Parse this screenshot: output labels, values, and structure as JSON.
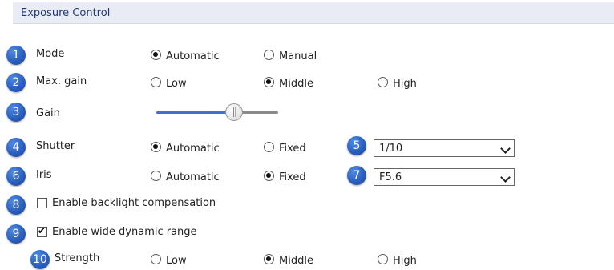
{
  "section_title": "Exposure Control",
  "rows": {
    "mode": {
      "num": "1",
      "label": "Mode",
      "options": [
        "Automatic",
        "Manual"
      ],
      "selected": "Automatic"
    },
    "max_gain": {
      "num": "2",
      "label": "Max. gain",
      "options": [
        "Low",
        "Middle",
        "High"
      ],
      "selected": "Middle"
    },
    "gain": {
      "num": "3",
      "label": "Gain",
      "value_fraction": 0.64
    },
    "shutter": {
      "num": "4",
      "label": "Shutter",
      "options": [
        "Automatic",
        "Fixed"
      ],
      "selected": "Automatic",
      "select_num": "5",
      "select_value": "1/10"
    },
    "iris": {
      "num": "6",
      "label": "Iris",
      "options": [
        "Automatic",
        "Fixed"
      ],
      "selected": "Fixed",
      "select_num": "7",
      "select_value": "F5.6"
    },
    "backlight": {
      "num": "8",
      "label": "Enable backlight compensation",
      "checked": false
    },
    "wdr": {
      "num": "9",
      "label": "Enable wide dynamic range",
      "checked": true
    },
    "strength": {
      "num": "10",
      "label": "Strength",
      "options": [
        "Low",
        "Middle",
        "High"
      ],
      "selected": "Middle"
    }
  },
  "colors": {
    "badge": "#2a5fbf",
    "slider_fill": "#3f6fd6",
    "header_bg": "#e9ebf5",
    "title": "#1f3b6f"
  }
}
